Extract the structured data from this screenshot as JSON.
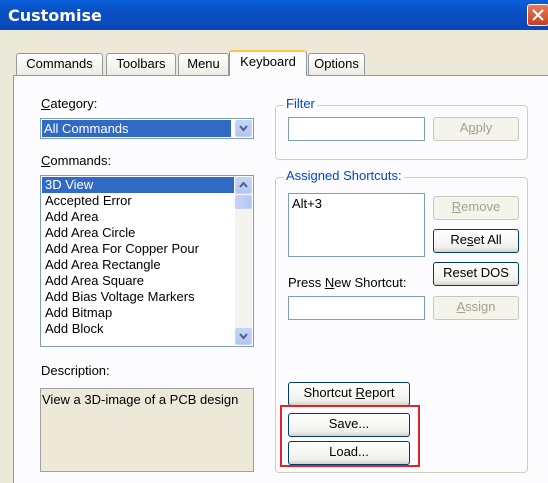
{
  "window": {
    "title": "Customise"
  },
  "tabs": [
    {
      "label": "Commands"
    },
    {
      "label": "Toolbars"
    },
    {
      "label": "Menu"
    },
    {
      "label": "Keyboard",
      "active": true
    },
    {
      "label": "Options"
    }
  ],
  "category": {
    "label_first": "C",
    "label_rest": "ategory:",
    "value": "All Commands"
  },
  "commands": {
    "label_first": "C",
    "label_rest": "ommands:",
    "items": [
      "3D View",
      "Accepted Error",
      "Add Area",
      "Add Area Circle",
      "Add Area For Copper Pour",
      "Add Area Rectangle",
      "Add Area Square",
      "Add Bias Voltage Markers",
      "Add Bitmap",
      "Add Block"
    ],
    "selected_index": 0
  },
  "description": {
    "label": "Description:",
    "text": "View a 3D-image of a PCB design"
  },
  "filter": {
    "legend": "Filter",
    "value": "",
    "apply": "Apply",
    "apply_first": "A",
    "apply_u": "p",
    "apply_rest": "ply"
  },
  "shortcuts": {
    "legend": "Assigned Shortcuts:",
    "items": [
      "Alt+3"
    ],
    "remove_first": "",
    "remove_u": "R",
    "remove_rest": "emove",
    "reset_all_first": "Re",
    "reset_all_u": "s",
    "reset_all_rest": "et All",
    "reset_dos": "Reset DOS",
    "press_new_first": "Press ",
    "press_new_u": "N",
    "press_new_rest": "ew Shortcut:",
    "new_value": "",
    "assign_first": "",
    "assign_u": "A",
    "assign_rest": "ssign"
  },
  "buttons": {
    "report_first": "Shortcut ",
    "report_u": "R",
    "report_rest": "eport",
    "save": "Save...",
    "load": "Load..."
  },
  "colors": {
    "highlight": "#e0242a",
    "selection": "#316ac5",
    "titlebar": "#0b4fc4"
  }
}
